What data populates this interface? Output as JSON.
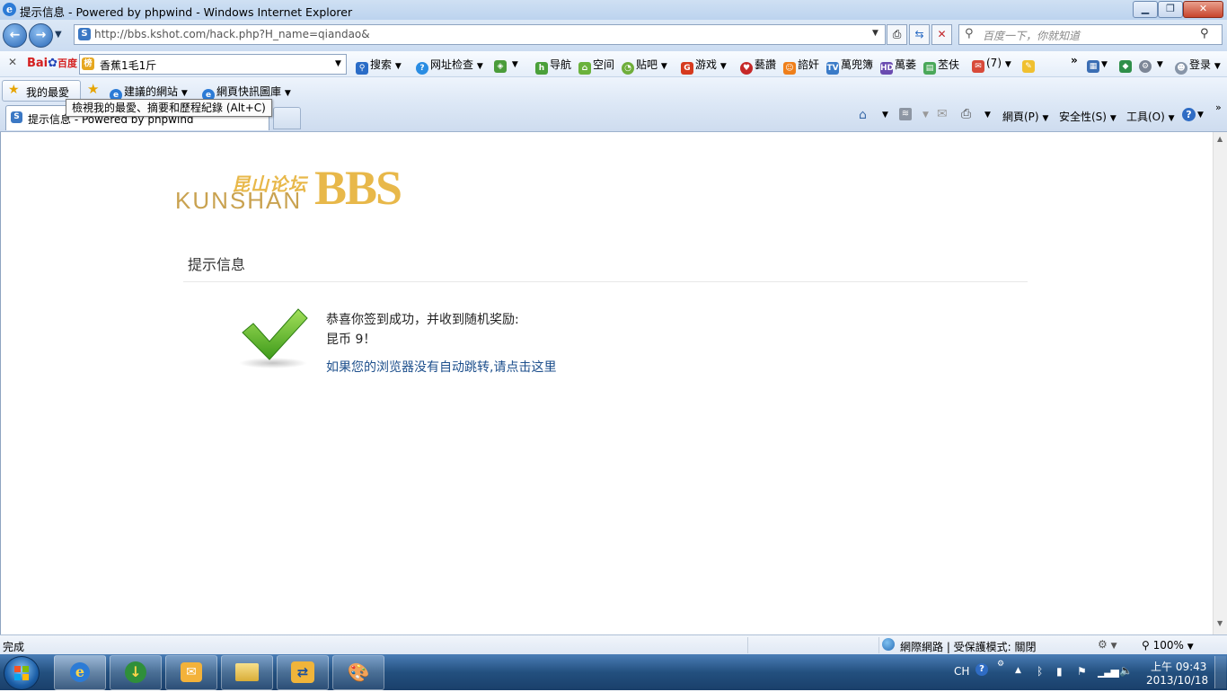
{
  "window": {
    "title": "提示信息 - Powered by phpwind - Windows Internet Explorer"
  },
  "address": {
    "url": "http://bbs.kshot.com/hack.php?H_name=qiandao&",
    "search_placeholder": "百度一下，你就知道"
  },
  "baidu_toolbar": {
    "brand": "Bai",
    "brand2": "百度",
    "input_value": "香蕉1毛1斤",
    "items": [
      "搜索",
      "网址检查",
      "导航",
      "空间",
      "贴吧",
      "游戏",
      "藝讚",
      "諮奸",
      "萬兜簿",
      "萬萎",
      "苤伕"
    ],
    "mail_count": "(7)",
    "login": "登录"
  },
  "favorites": {
    "favorites_label": "我的最愛",
    "suggested_sites": "建議的網站",
    "web_slice_gallery": "網頁快訊圖庫",
    "tooltip": "檢視我的最愛、摘要和歷程紀錄 (Alt+C)"
  },
  "tabs": {
    "active_tab_title": "提示信息 - Powered by phpwind"
  },
  "command_bar": {
    "page": "網頁(P)",
    "safety": "安全性(S)",
    "tools": "工具(O)"
  },
  "page": {
    "logo_cn": "昆山论坛",
    "logo_en": "KUNSHAN",
    "logo_bbs": "BBS",
    "heading": "提示信息",
    "message_line1": "恭喜你签到成功，并收到随机奖励:",
    "message_line2": "昆币 9！",
    "redirect_link": "如果您的浏览器没有自动跳转,请点击这里",
    "logo_color": "#e8b84a",
    "link_color": "#1d4f8c"
  },
  "status": {
    "left": "完成",
    "zone": "網際網路 | 受保護模式: 關閉",
    "zoom": "100%"
  },
  "taskbar": {
    "lang": "CH",
    "time": "上午 09:43",
    "date": "2013/10/18"
  }
}
